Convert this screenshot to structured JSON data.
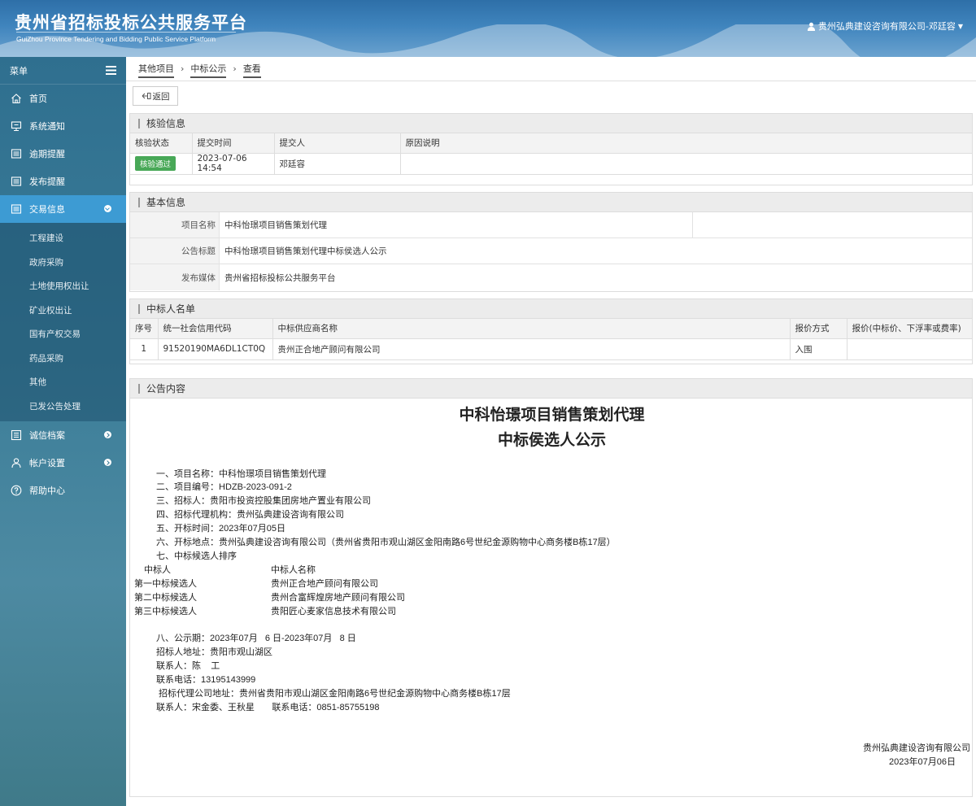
{
  "header": {
    "title": "贵州省招标投标公共服务平台",
    "subtitle": "GuiZhou Province Tendering and Bidding Public Service Platform",
    "user": "贵州弘典建设咨询有限公司-邓廷容"
  },
  "sidebar": {
    "menu_label": "菜单",
    "items": [
      {
        "label": "首页",
        "icon": "home-icon"
      },
      {
        "label": "系统通知",
        "icon": "monitor-icon"
      },
      {
        "label": "逾期提醒",
        "icon": "list-icon"
      },
      {
        "label": "发布提醒",
        "icon": "list-icon"
      },
      {
        "label": "交易信息",
        "icon": "list-icon"
      },
      {
        "label": "诚信档案",
        "icon": "archive-icon"
      },
      {
        "label": "帐户设置",
        "icon": "user-icon"
      },
      {
        "label": "帮助中心",
        "icon": "help-icon"
      }
    ],
    "sub_items": [
      "工程建设",
      "政府采购",
      "土地使用权出让",
      "矿业权出让",
      "国有产权交易",
      "药品采购",
      "其他",
      "已发公告处理"
    ]
  },
  "breadcrumb": [
    "其他项目",
    "中标公示",
    "查看"
  ],
  "back_button": "返回",
  "verify": {
    "title": "核验信息",
    "columns": [
      "核验状态",
      "提交时间",
      "提交人",
      "原因说明"
    ],
    "row": {
      "status": "核验通过",
      "time": "2023-07-06 14:54",
      "submitter": "邓廷容",
      "reason": ""
    }
  },
  "basic": {
    "title": "基本信息",
    "rows": [
      {
        "label": "项目名称",
        "value": "中科怡璟项目销售策划代理"
      },
      {
        "label": "公告标题",
        "value": "中科怡璟项目销售策划代理中标侯选人公示"
      },
      {
        "label": "发布媒体",
        "value": "贵州省招标投标公共服务平台"
      }
    ]
  },
  "winners": {
    "title": "中标人名单",
    "columns": [
      "序号",
      "统一社会信用代码",
      "中标供应商名称",
      "报价方式",
      "报价(中标价、下浮率或费率)"
    ],
    "rows": [
      {
        "no": "1",
        "code": "91520190MA6DL1CT0Q",
        "name": "贵州正合地产顾问有限公司",
        "method": "入围",
        "price": ""
      }
    ]
  },
  "announcement": {
    "title": "公告内容",
    "heading1": "中科怡璟项目销售策划代理",
    "heading2": "中标侯选人公示",
    "lines": [
      "一、项目名称：中科怡璟项目销售策划代理",
      "二、项目编号：HDZB-2023-091-2",
      "三、招标人：贵阳市投资控股集团房地产置业有限公司",
      "四、招标代理机构：贵州弘典建设咨询有限公司",
      "五、开标时间：2023年07月05日",
      "六、开标地点：贵州弘典建设咨询有限公司（贵州省贵阳市观山湖区金阳南路6号世纪金源购物中心商务楼B栋17层）",
      "七、中标候选人排序"
    ],
    "rank_header": [
      "中标人",
      "中标人名称"
    ],
    "ranks": [
      [
        "第一中标候选人",
        "贵州正合地产顾问有限公司"
      ],
      [
        "第二中标候选人",
        "贵州合富辉煌房地产顾问有限公司"
      ],
      [
        "第三中标候选人",
        "贵阳匠心麦家信息技术有限公司"
      ]
    ],
    "lines2": [
      "八、公示期：2023年07月   6 日-2023年07月   8 日",
      "招标人地址：贵阳市观山湖区",
      "联系人：陈    工",
      "联系电话：13195143999",
      " 招标代理公司地址：贵州省贵阳市观山湖区金阳南路6号世纪金源购物中心商务楼B栋17层",
      "联系人：宋金委、王秋星       联系电话：0851-85755198"
    ],
    "sign_company": "贵州弘典建设咨询有限公司",
    "sign_date": "2023年07月06日"
  }
}
